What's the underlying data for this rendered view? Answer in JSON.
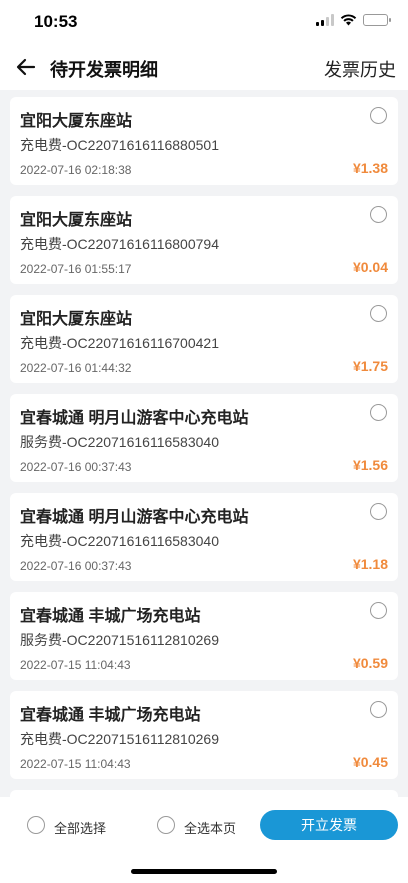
{
  "status": {
    "time": "10:53"
  },
  "header": {
    "title": "待开发票明细",
    "history": "发票历史"
  },
  "items": [
    {
      "station": "宜阳大厦东座站",
      "order": "充电费-OC22071616116880501",
      "time": "2022-07-16 02:18:38",
      "amount": "¥1.38"
    },
    {
      "station": "宜阳大厦东座站",
      "order": "充电费-OC22071616116800794",
      "time": "2022-07-16 01:55:17",
      "amount": "¥0.04"
    },
    {
      "station": "宜阳大厦东座站",
      "order": "充电费-OC22071616116700421",
      "time": "2022-07-16 01:44:32",
      "amount": "¥1.75"
    },
    {
      "station": "宜春城通 明月山游客中心充电站",
      "order": "服务费-OC22071616116583040",
      "time": "2022-07-16 00:37:43",
      "amount": "¥1.56"
    },
    {
      "station": "宜春城通 明月山游客中心充电站",
      "order": "充电费-OC22071616116583040",
      "time": "2022-07-16 00:37:43",
      "amount": "¥1.18"
    },
    {
      "station": "宜春城通 丰城广场充电站",
      "order": "服务费-OC22071516112810269",
      "time": "2022-07-15 11:04:43",
      "amount": "¥0.59"
    },
    {
      "station": "宜春城通 丰城广场充电站",
      "order": "充电费-OC22071516112810269",
      "time": "2022-07-15 11:04:43",
      "amount": "¥0.45"
    }
  ],
  "footer": {
    "select_all": "全部选择",
    "select_page": "全选本页",
    "submit": "开立发票"
  },
  "colors": {
    "amount": "#f08a3c",
    "primary": "#1a97d6"
  }
}
